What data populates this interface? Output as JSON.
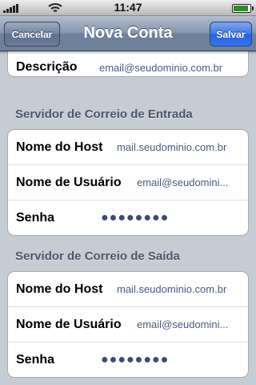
{
  "status_bar": {
    "time": "11:47"
  },
  "nav": {
    "title": "Nova Conta",
    "cancel_label": "Cancelar",
    "save_label": "Salvar"
  },
  "top_partial_row": {
    "label": "Descrição",
    "value": "email@seudominio.com.br"
  },
  "incoming": {
    "header": "Servidor de Correio de Entrada",
    "rows": [
      {
        "label": "Nome do Host",
        "value": "mail.seudominio.com.br"
      },
      {
        "label": "Nome de Usuário",
        "value": "email@seudomini..."
      },
      {
        "label": "Senha",
        "value": "●●●●●●●●"
      }
    ]
  },
  "outgoing": {
    "header": "Servidor de Correio de Saída",
    "rows": [
      {
        "label": "Nome do Host",
        "value": "mail.seudominio.com.br"
      },
      {
        "label": "Nome de Usuário",
        "value": "email@seudomini..."
      },
      {
        "label": "Senha",
        "value": "●●●●●●●●"
      }
    ]
  },
  "icons": {
    "signal": "signal-bars-icon",
    "wifi": "wifi-icon",
    "battery": "battery-icon"
  }
}
